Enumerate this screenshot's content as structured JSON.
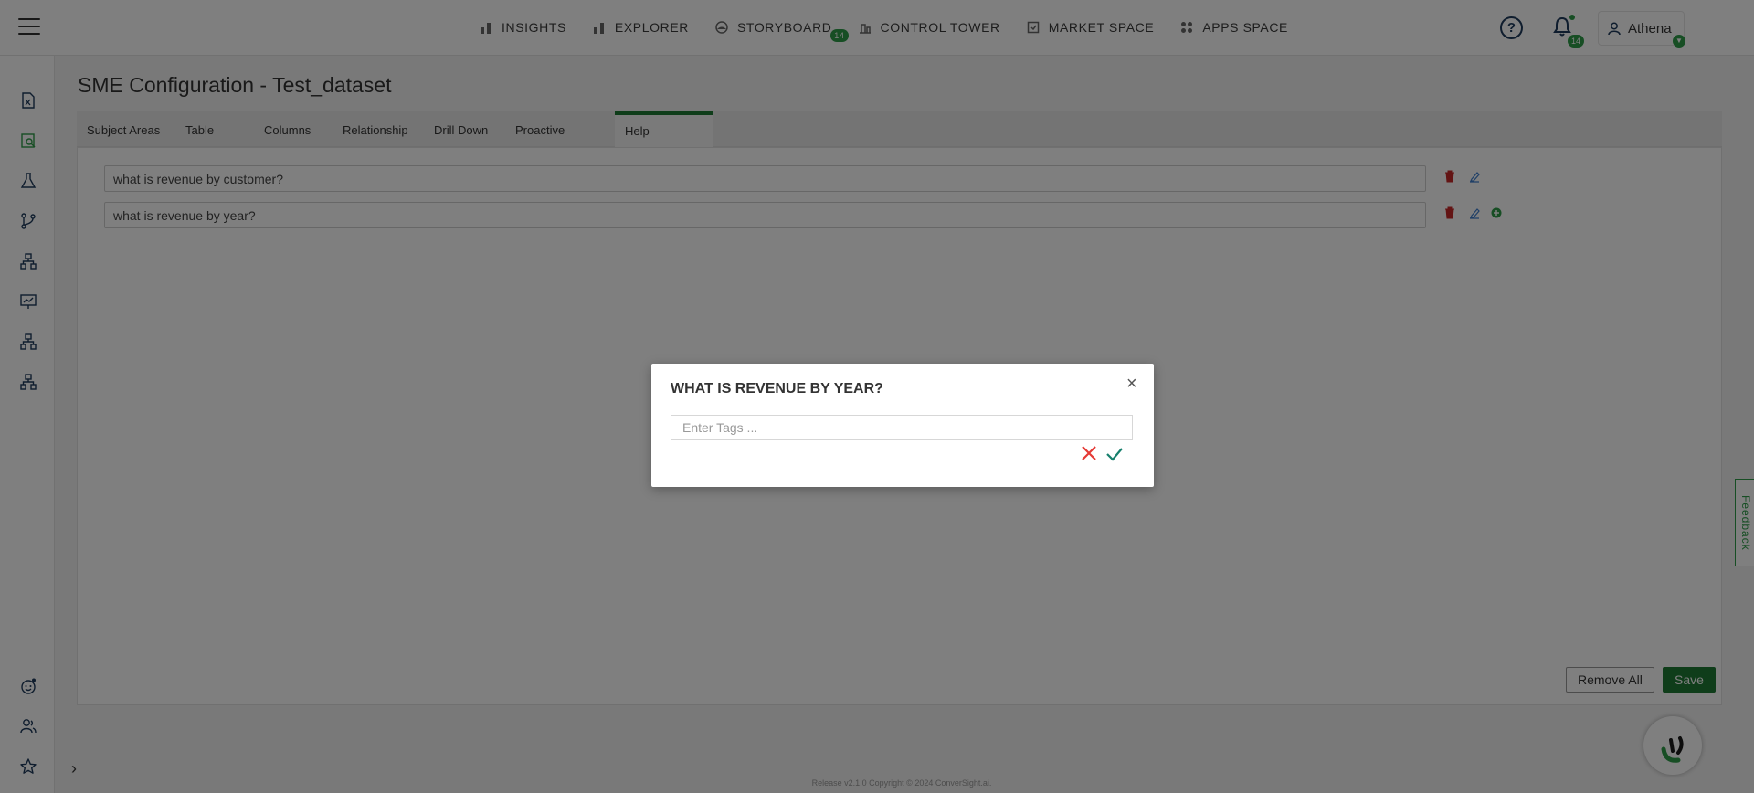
{
  "nav": {
    "items": [
      {
        "label": "INSIGHTS",
        "icon": "bar-chart-icon"
      },
      {
        "label": "EXPLORER",
        "icon": "bar-chart-icon"
      },
      {
        "label": "STORYBOARD",
        "icon": "storyboard-icon",
        "badge": "14"
      },
      {
        "label": "CONTROL TOWER",
        "icon": "tower-icon"
      },
      {
        "label": "MARKET SPACE",
        "icon": "market-icon"
      },
      {
        "label": "APPS SPACE",
        "icon": "grid-icon"
      }
    ],
    "help_label": "?",
    "notification_count": "14",
    "user_name": "Athena"
  },
  "sidebar": {
    "icons": [
      "excel-file-icon",
      "report-search-icon",
      "flask-icon",
      "git-branch-icon",
      "hierarchy-icon",
      "presentation-chart-icon",
      "hierarchy-icon",
      "hierarchy-icon",
      "bot-icon",
      "users-icon",
      "star-icon"
    ]
  },
  "page": {
    "title": "SME Configuration - Test_dataset",
    "tabs": [
      {
        "label": "Subject Areas"
      },
      {
        "label": "Table"
      },
      {
        "label": "Columns"
      },
      {
        "label": "Relationship"
      },
      {
        "label": "Drill Down"
      },
      {
        "label": "Proactive Insights"
      },
      {
        "label": "Help Questions",
        "active": true
      }
    ],
    "questions": [
      {
        "text": "what is revenue by customer?"
      },
      {
        "text": "what is revenue by year?"
      }
    ],
    "remove_all_label": "Remove All",
    "save_label": "Save",
    "footer": "Release v2.1.0 Copyright © 2024 ConverSight.ai.",
    "feedback_label": "Feedback"
  },
  "modal": {
    "title": "WHAT IS REVENUE BY YEAR?",
    "close": "×",
    "tags_placeholder": "Enter Tags ...",
    "tags_value": ""
  },
  "colors": {
    "accent": "#1e7a34",
    "badge": "#2e9d48",
    "danger": "#e53935",
    "confirm": "#17806d",
    "edit": "#3f7fcf"
  }
}
